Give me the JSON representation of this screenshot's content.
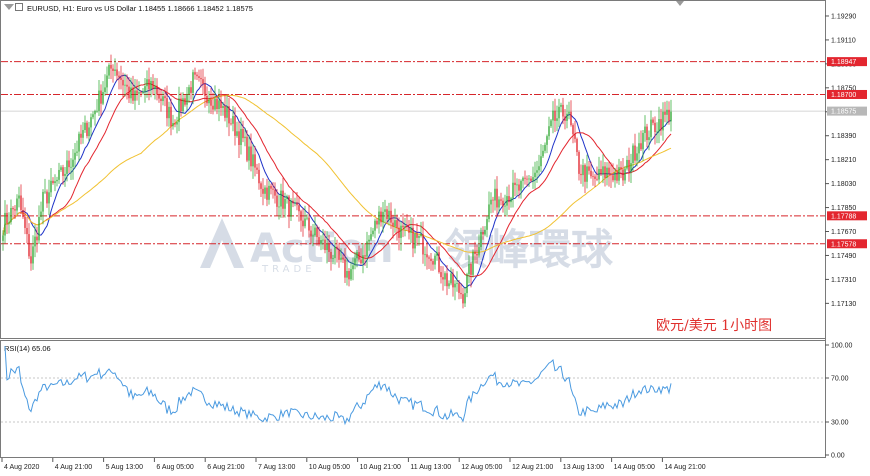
{
  "header": {
    "symbol_line": "EURUSD, H1:  Euro vs US Dollar  1.18455 1.18666 1.18452 1.18575"
  },
  "watermark": {
    "brand": "Action",
    "brand_cn": "領峰環球",
    "sub": "TRADE"
  },
  "caption": "欧元/美元  1小时图",
  "rsi": {
    "label": "RSI(14) 65.06"
  },
  "colors": {
    "bull": "#26a52a",
    "bear": "#e01b24",
    "ma_fast": "#1f33c8",
    "ma_mid": "#e3262f",
    "ma_slow": "#f1c232",
    "rsi_line": "#4a9ae0",
    "level_line": "#d6262b",
    "badge": "#e3262f",
    "current_badge": "#b8b8b8"
  },
  "chart_data": [
    {
      "type": "candlestick",
      "title": "EURUSD, H1",
      "ylim": [
        1.1705,
        1.1935
      ],
      "price_ticks": [
        "1.19290",
        "1.19110",
        "1.18930",
        "1.18750",
        "1.18570",
        "1.18390",
        "1.18210",
        "1.18030",
        "1.17850",
        "1.17670",
        "1.17490",
        "1.17310",
        "1.17130"
      ],
      "price_tick_values": [
        1.1929,
        1.1911,
        1.1893,
        1.1875,
        1.1857,
        1.1839,
        1.1821,
        1.1803,
        1.1785,
        1.1767,
        1.1749,
        1.1731,
        1.1713
      ],
      "time_labels": [
        "4 Aug 2020",
        "4 Aug 21:00",
        "5 Aug 13:00",
        "6 Aug 05:00",
        "6 Aug 21:00",
        "7 Aug 13:00",
        "10 Aug 05:00",
        "10 Aug 21:00",
        "11 Aug 13:00",
        "12 Aug 05:00",
        "12 Aug 21:00",
        "13 Aug 13:00",
        "14 Aug 05:00",
        "14 Aug 21:00"
      ],
      "levels": [
        {
          "label": "1.18947",
          "value": 1.18947
        },
        {
          "label": "1.18700",
          "value": 1.187
        },
        {
          "label": "1.17788",
          "value": 1.17788
        },
        {
          "label": "1.17578",
          "value": 1.17578
        }
      ],
      "current_price": {
        "label": "1.18575",
        "value": 1.18575
      },
      "anchors": [
        [
          0,
          1.1772
        ],
        [
          8,
          1.179
        ],
        [
          14,
          1.1745
        ],
        [
          20,
          1.179
        ],
        [
          32,
          1.1815
        ],
        [
          45,
          1.1855
        ],
        [
          55,
          1.1893
        ],
        [
          65,
          1.1866
        ],
        [
          75,
          1.1878
        ],
        [
          85,
          1.185
        ],
        [
          95,
          1.188
        ],
        [
          103,
          1.187
        ],
        [
          112,
          1.1855
        ],
        [
          120,
          1.1835
        ],
        [
          130,
          1.18
        ],
        [
          140,
          1.179
        ],
        [
          150,
          1.1775
        ],
        [
          158,
          1.176
        ],
        [
          165,
          1.175
        ],
        [
          172,
          1.1735
        ],
        [
          180,
          1.175
        ],
        [
          190,
          1.1785
        ],
        [
          200,
          1.1765
        ],
        [
          208,
          1.176
        ],
        [
          215,
          1.175
        ],
        [
          222,
          1.173
        ],
        [
          230,
          1.172
        ],
        [
          236,
          1.175
        ],
        [
          244,
          1.179
        ],
        [
          252,
          1.1795
        ],
        [
          260,
          1.18
        ],
        [
          268,
          1.1815
        ],
        [
          275,
          1.185
        ],
        [
          282,
          1.1858
        ],
        [
          288,
          1.1815
        ],
        [
          295,
          1.1805
        ],
        [
          302,
          1.1812
        ],
        [
          310,
          1.1808
        ],
        [
          318,
          1.1835
        ],
        [
          326,
          1.1847
        ],
        [
          334,
          1.1857
        ]
      ],
      "series": [
        {
          "kind": "ma",
          "period": 10,
          "color": "#1f33c8"
        },
        {
          "kind": "ma",
          "period": 22,
          "color": "#e3262f"
        },
        {
          "kind": "ma",
          "period": 70,
          "color": "#f1c232"
        }
      ]
    },
    {
      "type": "line",
      "title": "RSI(14) 65.06",
      "ylim": [
        0,
        100
      ],
      "ticks": [
        "100.00",
        "70.00",
        "30.00",
        "0.00"
      ],
      "tick_values": [
        100,
        70,
        30,
        0
      ],
      "levels": [
        70,
        30
      ],
      "last_value": 65.06
    }
  ]
}
